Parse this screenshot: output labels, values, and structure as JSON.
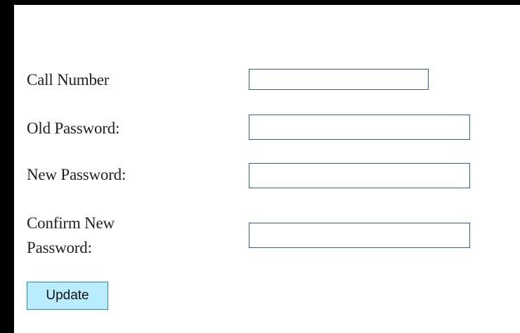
{
  "form": {
    "call_number_label": "Call Number",
    "old_password_label": "Old Password:",
    "new_password_label": "New Password:",
    "confirm_password_label_line1": "Confirm New",
    "confirm_password_label_line2": "Password:",
    "call_number_value": "",
    "old_password_value": "",
    "new_password_value": "",
    "confirm_password_value": "",
    "update_label": "Update"
  },
  "colors": {
    "frame": "#000000",
    "field_border": "#2e5f8f",
    "button_fill": "#b9ecff",
    "button_border": "#2b89a3"
  }
}
